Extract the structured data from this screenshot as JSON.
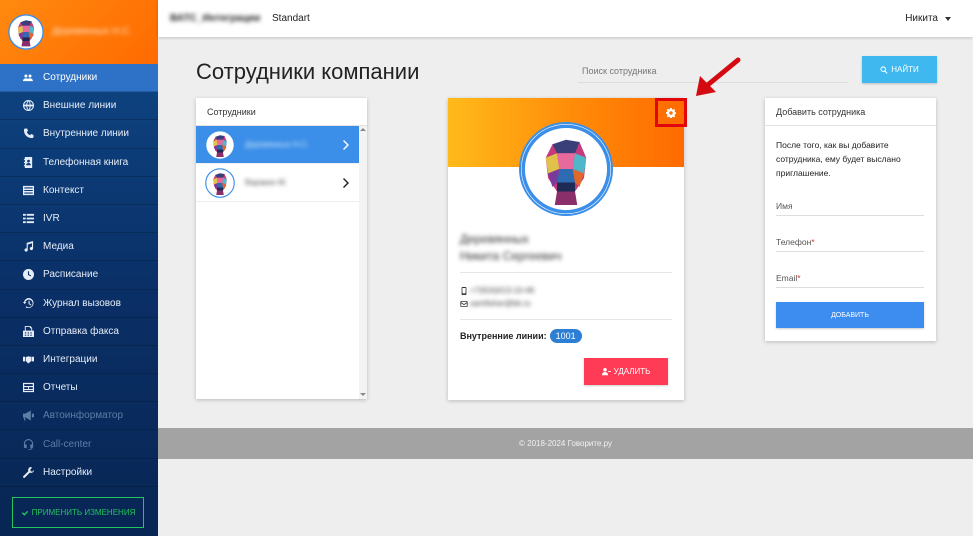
{
  "sidebar": {
    "user_name": "Деревянных Н.С.",
    "items": [
      {
        "label": "Сотрудники",
        "icon": "users-icon",
        "state": "active"
      },
      {
        "label": "Внешние линии",
        "icon": "globe-icon",
        "state": "normal"
      },
      {
        "label": "Внутренние линии",
        "icon": "phone-icon",
        "state": "normal"
      },
      {
        "label": "Телефонная книга",
        "icon": "address-book-icon",
        "state": "normal"
      },
      {
        "label": "Контекст",
        "icon": "list-icon",
        "state": "normal"
      },
      {
        "label": "IVR",
        "icon": "ivr-icon",
        "state": "normal"
      },
      {
        "label": "Медиа",
        "icon": "music-icon",
        "state": "normal"
      },
      {
        "label": "Расписание",
        "icon": "clock-icon",
        "state": "normal"
      },
      {
        "label": "Журнал вызовов",
        "icon": "history-icon",
        "state": "normal"
      },
      {
        "label": "Отправка факса",
        "icon": "fax-icon",
        "state": "normal"
      },
      {
        "label": "Интеграции",
        "icon": "handshake-icon",
        "state": "normal"
      },
      {
        "label": "Отчеты",
        "icon": "report-icon",
        "state": "normal"
      },
      {
        "label": "Автоинформатор",
        "icon": "megaphone-icon",
        "state": "disabled"
      },
      {
        "label": "Call-center",
        "icon": "headset-icon",
        "state": "disabled"
      },
      {
        "label": "Настройки",
        "icon": "wrench-icon",
        "state": "normal"
      }
    ],
    "apply_label": "ПРИМЕНИТЬ ИЗМЕНЕНИЯ"
  },
  "topbar": {
    "company": "ВАТС_Интеграции",
    "plan": "Standart",
    "user": "Никита"
  },
  "page": {
    "title": "Сотрудники компании",
    "search_placeholder": "Поиск сотрудника",
    "search_button": "НАЙТИ"
  },
  "employees": {
    "header": "Сотрудники",
    "list": [
      {
        "name": "Деревянных Н.С.",
        "selected": true
      },
      {
        "name": "Варакин М.",
        "selected": false
      }
    ]
  },
  "card": {
    "surname": "Деревянных",
    "given_name": "Никита Сергеевич",
    "phone": "+7(916)013-10-46",
    "email": "samfisher@bk.ru",
    "internal_lines_label": "Внутренние линии:",
    "internal_line": "1001",
    "delete_label": "УДАЛИТЬ"
  },
  "add_employee": {
    "header": "Добавить сотрудника",
    "description": "После того, как вы добавите сотрудника, ему будет выслано приглашение.",
    "name_label": "Имя",
    "phone_label": "Телефон",
    "email_label": "Email",
    "required_mark": "*",
    "add_label": "ДОБАВИТЬ"
  },
  "footer": {
    "copyright": "© 2018-2024 Говорите.ру"
  },
  "colors": {
    "sidebar_top": "#0f4a8a",
    "sidebar_active": "#2d72c6",
    "profile_orange": "#ff7a00",
    "search_button": "#3fb8ef",
    "delete_button": "#ff3b56",
    "add_button": "#3d8cf0",
    "annotation_red": "#e0060c"
  }
}
